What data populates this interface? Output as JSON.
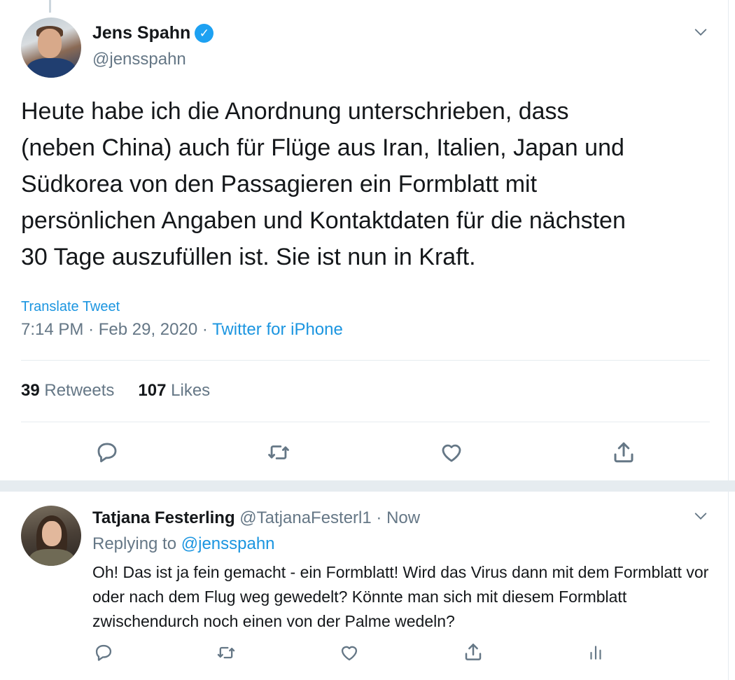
{
  "main_tweet": {
    "author_name": "Jens Spahn",
    "author_handle": "@jensspahn",
    "verified": true,
    "text": "Heute habe ich die Anordnung unterschrieben, dass\n(neben China) auch für Flüge aus Iran, Italien, Japan und\nSüdkorea von den Passagieren ein Formblatt mit\npersönlichen Angaben und Kontaktdaten für die nächsten\n30 Tage auszufüllen ist. Sie ist nun in Kraft.",
    "translate_label": "Translate Tweet",
    "time": "7:14 PM",
    "date": "Feb 29, 2020",
    "source": "Twitter for iPhone",
    "retweets_count": "39",
    "retweets_label": "Retweets",
    "likes_count": "107",
    "likes_label": "Likes"
  },
  "reply": {
    "author_name": "Tatjana Festerling",
    "author_handle": "@TatjanaFesterl1",
    "time": "Now",
    "replying_prefix": "Replying to",
    "replying_to": "@jensspahn",
    "text": "Oh! Das ist ja fein gemacht - ein Formblatt! Wird das Virus dann mit dem Formblatt vor oder nach dem Flug weg gewedelt? Könnte man sich mit diesem Formblatt zwischendurch noch einen von der Palme wedeln?"
  },
  "icons": {
    "reply": "reply-icon",
    "retweet": "retweet-icon",
    "like": "heart-icon",
    "share": "share-icon",
    "analytics": "analytics-icon",
    "more": "chevron-down-icon",
    "verified": "verified-badge-icon"
  },
  "colors": {
    "accent": "#1b95e0",
    "verified": "#1da1f2",
    "secondary_text": "#657786",
    "divider": "#e6ecf0"
  }
}
